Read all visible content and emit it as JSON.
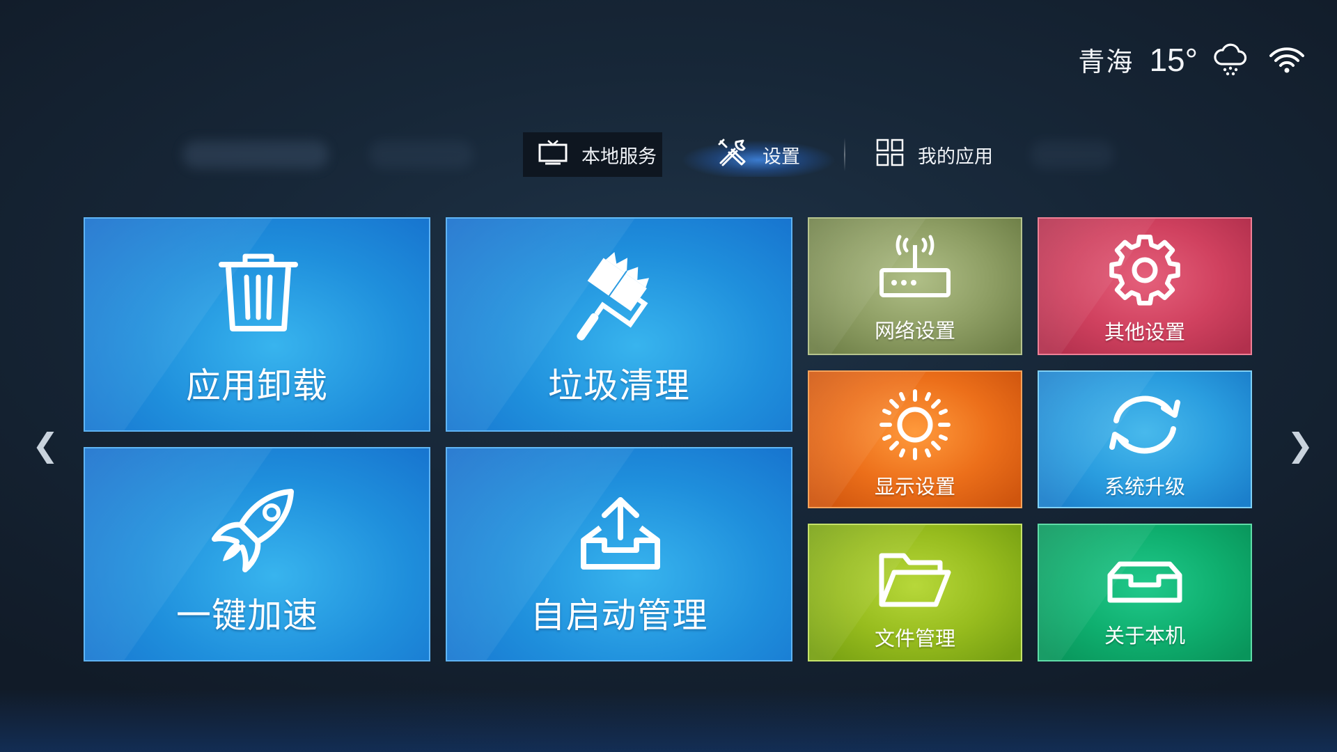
{
  "status": {
    "city": "青海",
    "temperature": "15°",
    "weather_icon": "snow-cloud-icon",
    "network_icon": "wifi-icon"
  },
  "nav": {
    "tabs": [
      {
        "id": "local",
        "label": "本地服务",
        "icon": "tv-icon"
      },
      {
        "id": "settings",
        "label": "设置",
        "icon": "tools-icon",
        "active": true
      },
      {
        "id": "apps",
        "label": "我的应用",
        "icon": "grid-icon"
      }
    ]
  },
  "tiles": {
    "uninstall": {
      "label": "应用卸载",
      "icon": "trash-icon"
    },
    "clean": {
      "label": "垃圾清理",
      "icon": "paint-roller-icon"
    },
    "boost": {
      "label": "一键加速",
      "icon": "rocket-icon"
    },
    "autostart": {
      "label": "自启动管理",
      "icon": "upload-tray-icon"
    },
    "network": {
      "label": "网络设置",
      "icon": "router-icon",
      "color": "#8e9e64"
    },
    "other": {
      "label": "其他设置",
      "icon": "gear-icon",
      "color": "#d0415f"
    },
    "display": {
      "label": "显示设置",
      "icon": "sun-icon",
      "color": "#ec6f1a"
    },
    "upgrade": {
      "label": "系统升级",
      "icon": "refresh-icon",
      "color": "#2a9ddf"
    },
    "files": {
      "label": "文件管理",
      "icon": "folder-icon",
      "color": "#97bc1e"
    },
    "about": {
      "label": "关于本机",
      "icon": "inbox-icon",
      "color": "#0faf6f"
    }
  },
  "arrows": {
    "left": "❮",
    "right": "❯"
  }
}
